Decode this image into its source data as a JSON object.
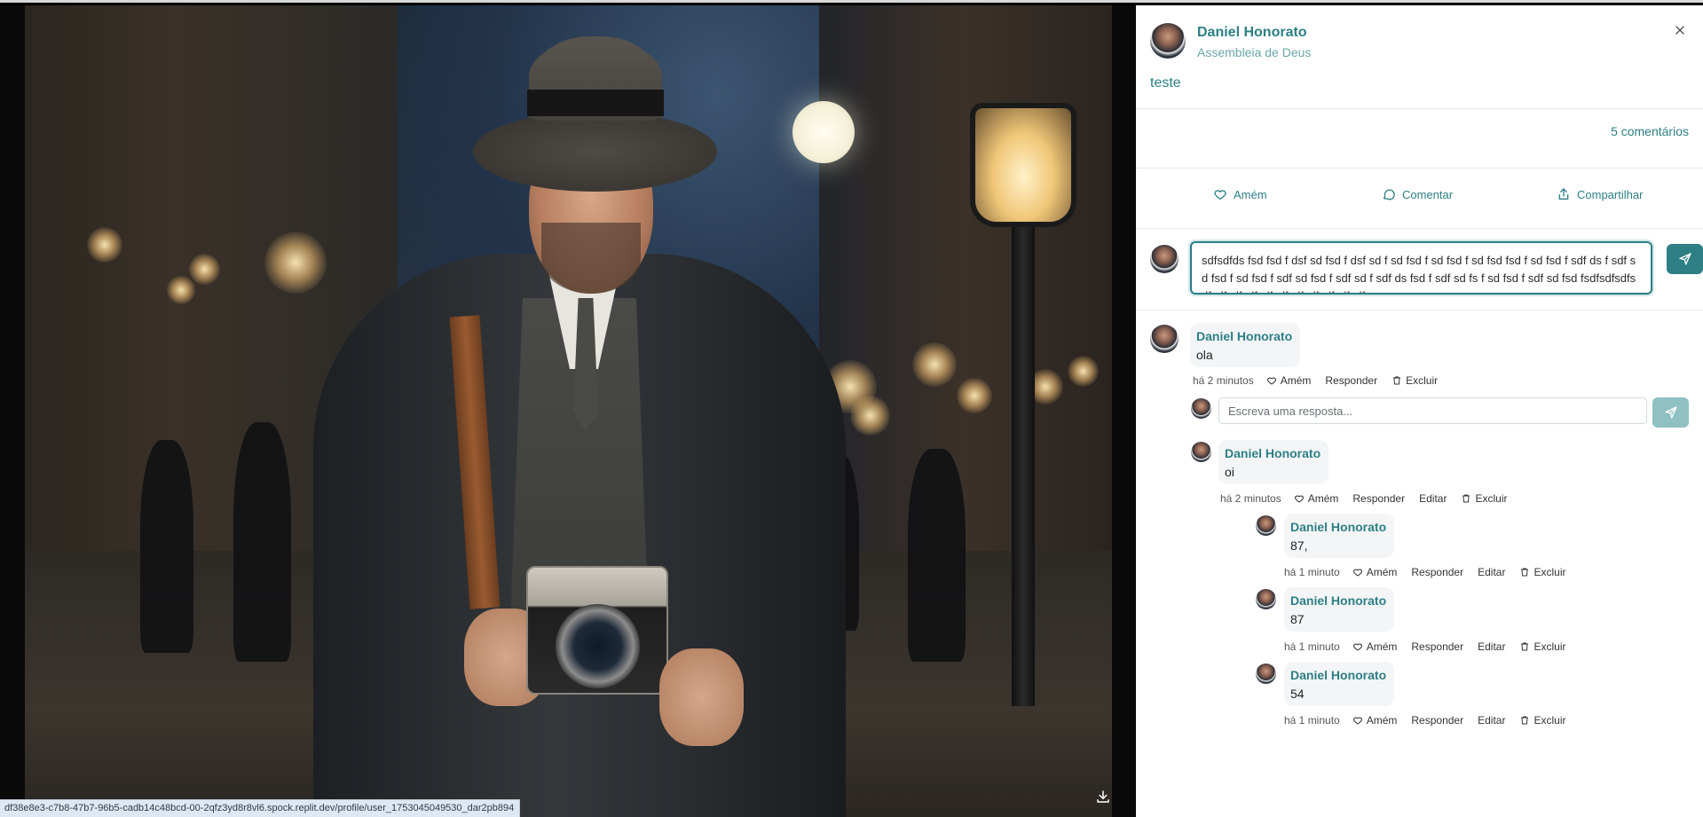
{
  "post": {
    "author_name": "Daniel Honorato",
    "author_church": "Assembleia de Deus",
    "text": "teste",
    "comments_count": "5 comentários"
  },
  "actions": {
    "amen": "Amém",
    "comment": "Comentar",
    "share": "Compartilhar"
  },
  "compose": {
    "value": "sdfsdfds fsd fsd f dsf sd fsd f dsf sd f sd fsd f sd fsd f sd fsd fsd f sd fsd f sdf ds f sdf sd fsd f sd fsd f sdf sd fsd f sdf sd f sdf ds fsd f sdf sd fs f sd fsd f sdf sd fsd fsdfsdfsdfsdfsdfsdfsdfsdfsdfsdfsdfsdfsdfsdf"
  },
  "comments": [
    {
      "name": "Daniel Honorato",
      "text": "ola",
      "time": "há 2 minutos",
      "amen": "Amém",
      "reply": "Responder",
      "delete": "Excluir"
    }
  ],
  "reply_box": {
    "placeholder": "Escreva uma resposta..."
  },
  "replies": [
    {
      "name": "Daniel Honorato",
      "text": "oi",
      "time": "há 2 minutos",
      "amen": "Amém",
      "reply": "Responder",
      "edit": "Editar",
      "delete": "Excluir"
    },
    {
      "name": "Daniel Honorato",
      "text": "87,",
      "time": "há 1 minuto",
      "amen": "Amém",
      "reply": "Responder",
      "edit": "Editar",
      "delete": "Excluir"
    },
    {
      "name": "Daniel Honorato",
      "text": "87",
      "time": "há 1 minuto",
      "amen": "Amém",
      "reply": "Responder",
      "edit": "Editar",
      "delete": "Excluir"
    },
    {
      "name": "Daniel Honorato",
      "text": "54",
      "time": "há 1 minuto",
      "amen": "Amém",
      "reply": "Responder",
      "edit": "Editar",
      "delete": "Excluir"
    }
  ],
  "status_bar": {
    "url": "df38e8e3-c7b8-47b7-96b5-cadb14c48bcd-00-2qfz3yd8r8vl6.spock.replit.dev/profile/user_1753045049530_dar2pb894"
  },
  "icons": {
    "close": "close-icon",
    "heart": "heart-icon",
    "comment": "comment-icon",
    "share": "share-icon",
    "send": "send-icon",
    "trash": "trash-icon",
    "download": "download-icon"
  },
  "colors": {
    "accent": "#2d7f84",
    "accent_light": "#8fc0c2",
    "bubble": "#f4f5f6"
  }
}
